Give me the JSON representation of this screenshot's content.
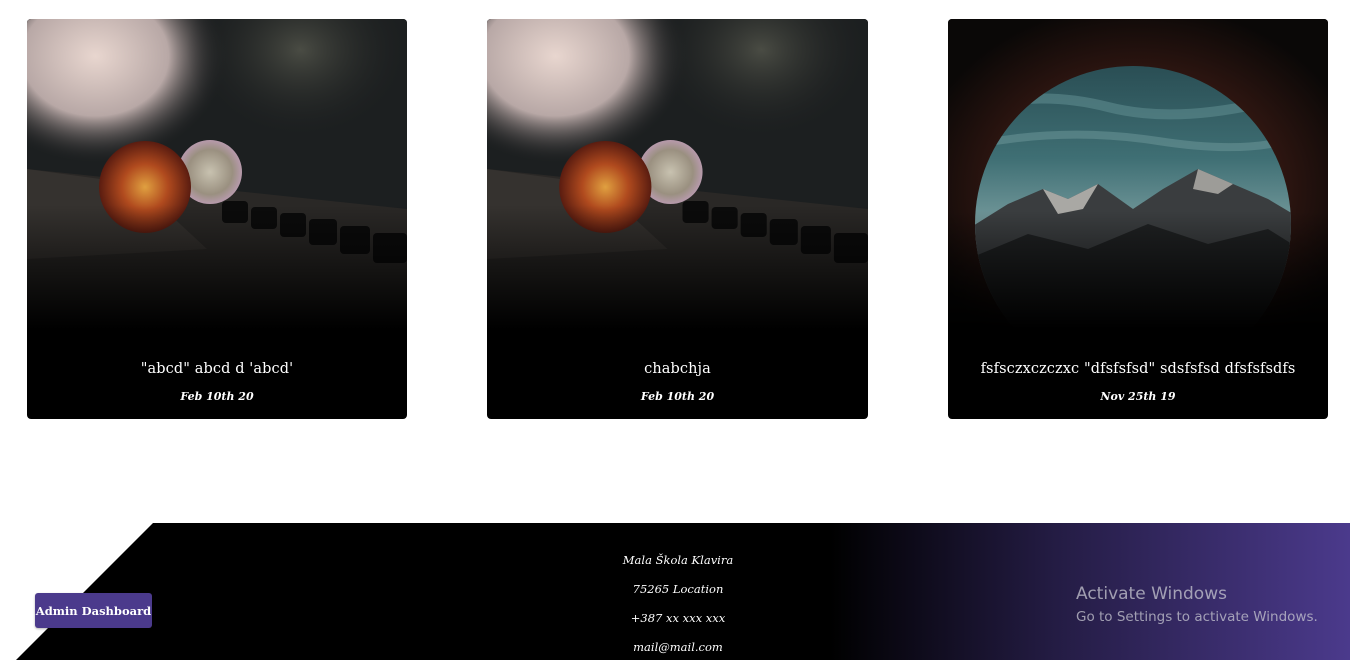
{
  "cards": [
    {
      "title": "\"abcd\" abcd d 'abcd'",
      "date": "Feb 10th 20",
      "image": "piano-flowers-photo"
    },
    {
      "title": "chabchja",
      "date": "Feb 10th 20",
      "image": "piano-flowers-photo"
    },
    {
      "title": "fsfsczxczczxc \"dfsfsfsd\" sdsfsfsd dfsfsfsdfs",
      "date": "Nov 25th 19",
      "image": "mountain-porthole-photo"
    }
  ],
  "footer": {
    "name": "Mala Škola Klavira",
    "location": "75265 Location",
    "phone": "+387 xx xxx xxx",
    "email": "mail@mail.com",
    "accent_color": "#4b3a8c"
  },
  "admin_button": {
    "label": "Admin Dashboard"
  },
  "watermark": {
    "title": "Activate Windows",
    "subtitle": "Go to Settings to activate Windows."
  }
}
